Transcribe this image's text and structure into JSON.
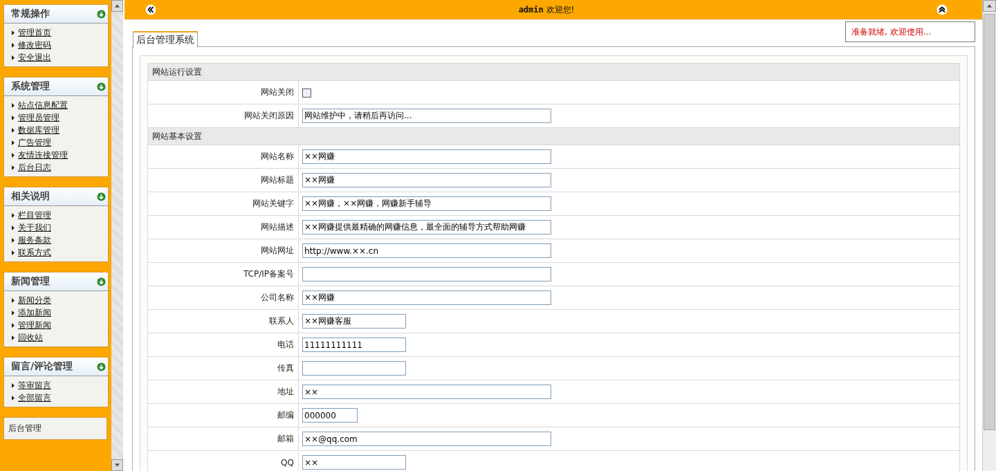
{
  "sidebar": {
    "sections": [
      {
        "title": "常规操作",
        "items": [
          "管理首页",
          "修改密码",
          "安全退出"
        ]
      },
      {
        "title": "系统管理",
        "items": [
          "站点信息配置",
          "管理员管理",
          "数据库管理",
          "广告管理",
          "友情连接管理",
          "后台日志"
        ]
      },
      {
        "title": "相关说明",
        "items": [
          "栏目管理",
          "关于我们",
          "服务条款",
          "联系方式"
        ]
      },
      {
        "title": "新闻管理",
        "items": [
          "新闻分类",
          "添加新闻",
          "管理新闻",
          "回收站"
        ]
      },
      {
        "title": "留言/评论管理",
        "items": [
          "等审留言",
          "全部留言"
        ]
      }
    ],
    "footer": "后台管理"
  },
  "topbar": {
    "user": "admin",
    "greeting": "欢迎您!"
  },
  "status": "准备就绪, 欢迎使用...",
  "tab": {
    "label": "后台管理系统",
    "selected": true
  },
  "form": {
    "sections": [
      {
        "title": "网站运行设置",
        "rows": [
          {
            "kind": "checkbox",
            "label": "网站关闭",
            "checked": false
          },
          {
            "kind": "wide",
            "label": "网站关闭原因",
            "value": "网站维护中，请稍后再访问..."
          }
        ]
      },
      {
        "title": "网站基本设置",
        "rows": [
          {
            "kind": "wide",
            "label": "网站名称",
            "value": "××网赚"
          },
          {
            "kind": "wide",
            "label": "网站标题",
            "value": "××网赚"
          },
          {
            "kind": "wide",
            "label": "网站关键字",
            "value": "××网赚，××网赚，网赚新手辅导"
          },
          {
            "kind": "wide",
            "label": "网站描述",
            "value": "××网赚提供最精确的网赚信息，最全面的辅导方式帮助网赚"
          },
          {
            "kind": "wide",
            "label": "网站网址",
            "value": "http://www.××.cn"
          },
          {
            "kind": "wide",
            "label": "TCP/IP备案号",
            "value": ""
          },
          {
            "kind": "wide",
            "label": "公司名称",
            "value": "××网赚"
          },
          {
            "kind": "medium",
            "label": "联系人",
            "value": "××网赚客服"
          },
          {
            "kind": "medium",
            "label": "电话",
            "value": "11111111111"
          },
          {
            "kind": "medium",
            "label": "传真",
            "value": ""
          },
          {
            "kind": "wide",
            "label": "地址",
            "value": "××"
          },
          {
            "kind": "short",
            "label": "邮编",
            "value": "000000"
          },
          {
            "kind": "wide",
            "label": "邮箱",
            "value": "××@qq.com"
          },
          {
            "kind": "medium",
            "label": "QQ",
            "value": "××"
          }
        ]
      }
    ]
  }
}
